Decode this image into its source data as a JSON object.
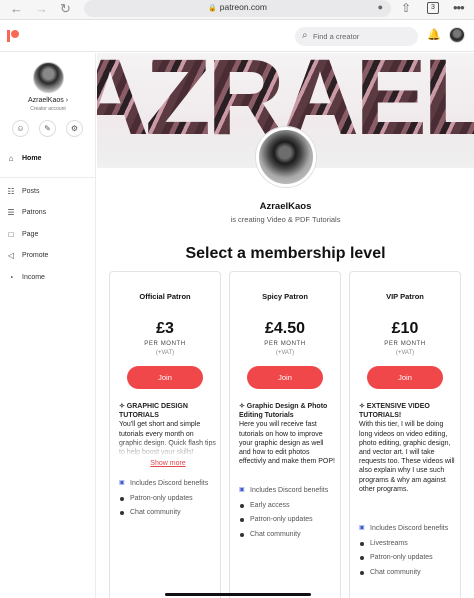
{
  "browser": {
    "url": "patreon.com",
    "tab_count": "3",
    "back_glyph": "←",
    "forward_glyph": "→",
    "reload_glyph": "↻",
    "lock_glyph": "🔒",
    "mic_glyph": "●",
    "share_glyph": "⇧",
    "more_glyph": "•••"
  },
  "header": {
    "search_placeholder": "Find a creator",
    "search_glyph": "⌕",
    "bell_glyph": "🔔",
    "brand_color": "#f96854"
  },
  "sidebar": {
    "name": "AzraelKaos ›",
    "subtitle": "Creator account",
    "action_glyphs": [
      "☺",
      "✎",
      "⚙"
    ],
    "items": [
      {
        "label": "Home",
        "icon": "home-icon",
        "glyph": "⌂"
      },
      {
        "label": "Posts",
        "icon": "posts-icon",
        "glyph": "☷"
      },
      {
        "label": "Patrons",
        "icon": "patrons-icon",
        "glyph": "☰"
      },
      {
        "label": "Page",
        "icon": "page-icon",
        "glyph": "□"
      },
      {
        "label": "Promote",
        "icon": "promote-icon",
        "glyph": "◁"
      },
      {
        "label": "Income",
        "icon": "income-icon",
        "glyph": "◔"
      }
    ]
  },
  "creator": {
    "banner_text": "AZRAEL KAOS",
    "name": "AzraelKaos",
    "tagline": "is creating Video & PDF Tutorials"
  },
  "membership": {
    "heading": "Select a membership level",
    "accent_color": "#f0474a",
    "tiers": [
      {
        "title": "Official Patron",
        "price": "£3",
        "per": "PER MONTH",
        "vat": "(+VAT)",
        "join": "Join",
        "desc_head": "✧ GRAPHIC DESIGN TUTORIALS",
        "desc_body": "You'll get short and simple tutorials every month on graphic design. Quick flash tips to help boost your skills!",
        "show_more": "Show more",
        "benefits": [
          {
            "text": "Includes Discord benefits",
            "kind": "discord"
          },
          {
            "text": "Patron-only updates",
            "kind": "dot"
          },
          {
            "text": "Chat community",
            "kind": "dot"
          }
        ]
      },
      {
        "title": "Spicy Patron",
        "price": "£4.50",
        "per": "PER MONTH",
        "vat": "(+VAT)",
        "join": "Join",
        "desc_head": "✧ Graphic Design & Photo Editing Tutorials",
        "desc_body": "Here you will receive fast tutorials on how to improve your graphic design as well and how to edit photos effectivly and make them POP!",
        "benefits": [
          {
            "text": "Includes Discord benefits",
            "kind": "discord"
          },
          {
            "text": "Early access",
            "kind": "dot"
          },
          {
            "text": "Patron-only updates",
            "kind": "dot"
          },
          {
            "text": "Chat community",
            "kind": "dot"
          }
        ]
      },
      {
        "title": "VIP Patron",
        "price": "£10",
        "per": "PER MONTH",
        "vat": "(+VAT)",
        "join": "Join",
        "desc_head": "✧ EXTENSIVE VIDEO TUTORIALS!",
        "desc_body": "With this tier, I will be doing long videos on video editing, photo editing, graphic design, and vector art. I will take requests too. These videos will also explain why I use such programs & why am against other programs.",
        "benefits": [
          {
            "text": "Includes Discord benefits",
            "kind": "discord"
          },
          {
            "text": "Livestreams",
            "kind": "dot"
          },
          {
            "text": "Patron-only updates",
            "kind": "dot"
          },
          {
            "text": "Chat community",
            "kind": "dot"
          }
        ]
      }
    ]
  }
}
